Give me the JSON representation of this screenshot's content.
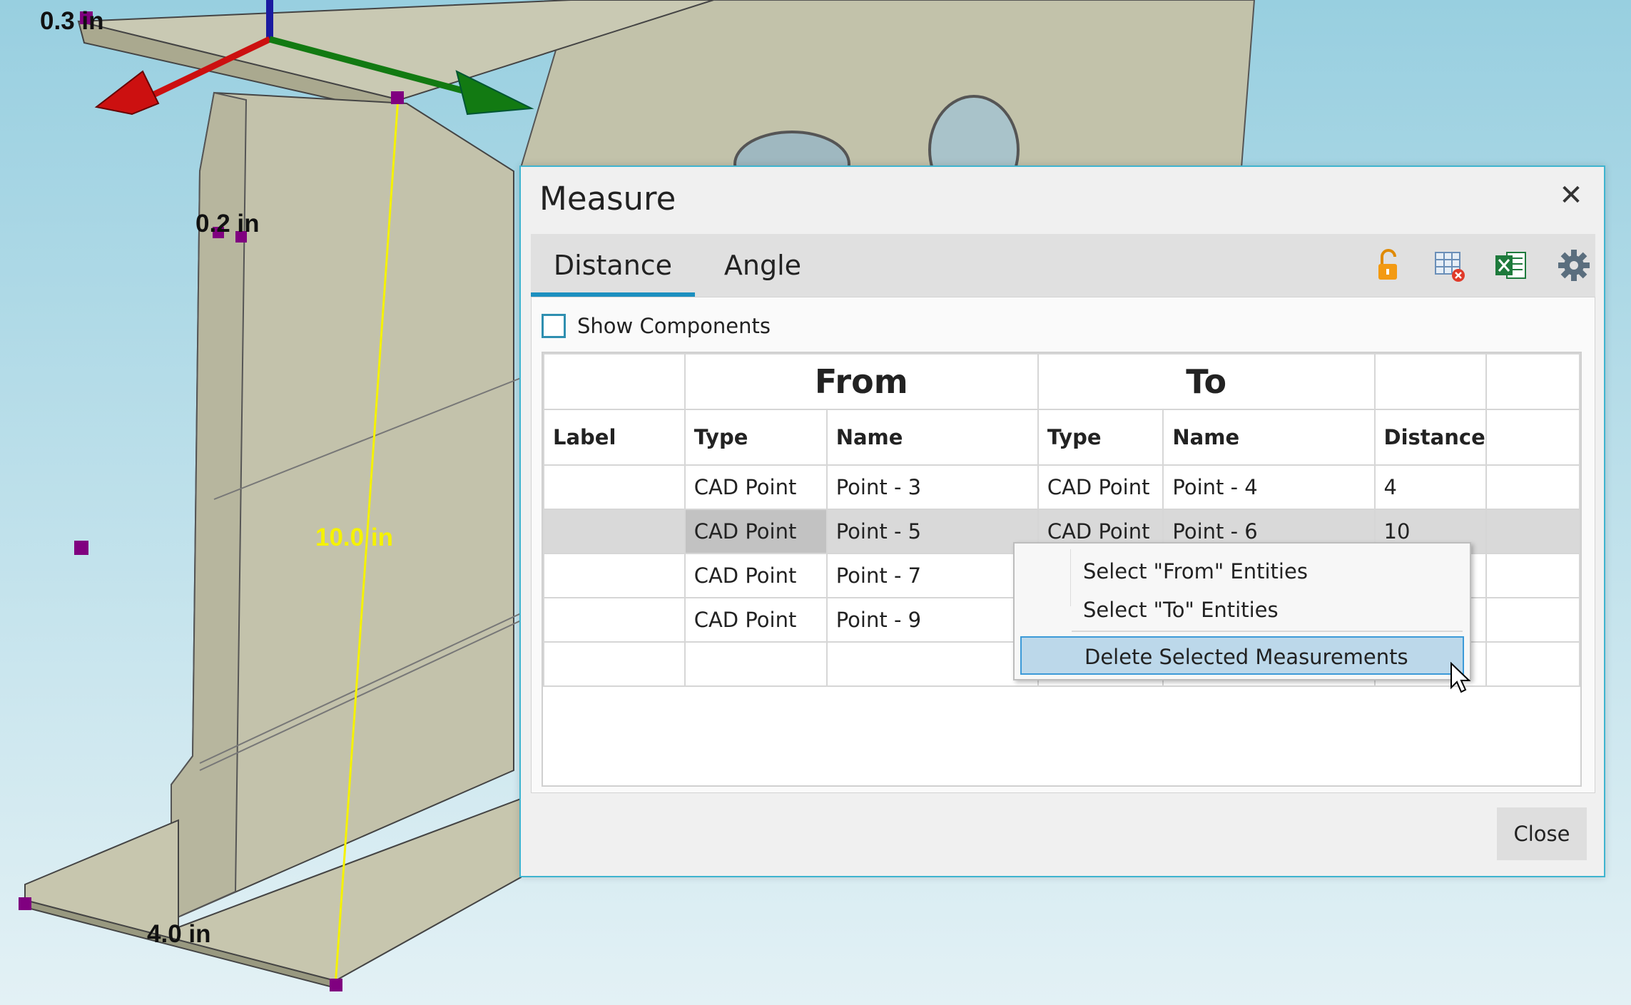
{
  "viewport": {
    "labels": {
      "dim_flange_thickness": "0.3 in",
      "dim_web_thickness": "0.2 in",
      "dim_height": "10.0 in",
      "dim_flange_width": "4.0 in"
    }
  },
  "dialog": {
    "title": "Measure",
    "tabs": [
      {
        "label": "Distance",
        "active": true
      },
      {
        "label": "Angle",
        "active": false
      }
    ],
    "toolbar_icons": [
      "unlock-icon",
      "clear-table-icon",
      "excel-export-icon",
      "gear-icon"
    ],
    "show_components_label": "Show Components",
    "show_components_checked": false,
    "grid": {
      "group_headers": {
        "from": "From",
        "to": "To"
      },
      "columns": {
        "label": "Label",
        "from_type": "Type",
        "from_name": "Name",
        "to_type": "Type",
        "to_name": "Name",
        "distance": "Distance"
      },
      "rows": [
        {
          "label": "",
          "from_type": "CAD Point",
          "from_name": "Point - 3",
          "to_type": "CAD Point",
          "to_name": "Point - 4",
          "distance": "4"
        },
        {
          "label": "",
          "from_type": "CAD Point",
          "from_name": "Point - 5",
          "to_type": "CAD Point",
          "to_name": "Point - 6",
          "distance": "10"
        },
        {
          "label": "",
          "from_type": "CAD Point",
          "from_name": "Point - 7",
          "to_type": "",
          "to_name": "",
          "distance": ""
        },
        {
          "label": "",
          "from_type": "CAD Point",
          "from_name": "Point - 9",
          "to_type": "",
          "to_name": "",
          "distance": ""
        }
      ]
    },
    "close_label": "Close"
  },
  "context_menu": {
    "items": [
      "Select \"From\" Entities",
      "Select \"To\" Entities",
      "Delete Selected Measurements"
    ]
  },
  "colors": {
    "accent": "#1c8fbf",
    "dialog_border": "#3fb4cf",
    "menu_highlight": "#bcd8ea",
    "measure_line": "#f5f200",
    "model_face": "#c6c6ae"
  }
}
